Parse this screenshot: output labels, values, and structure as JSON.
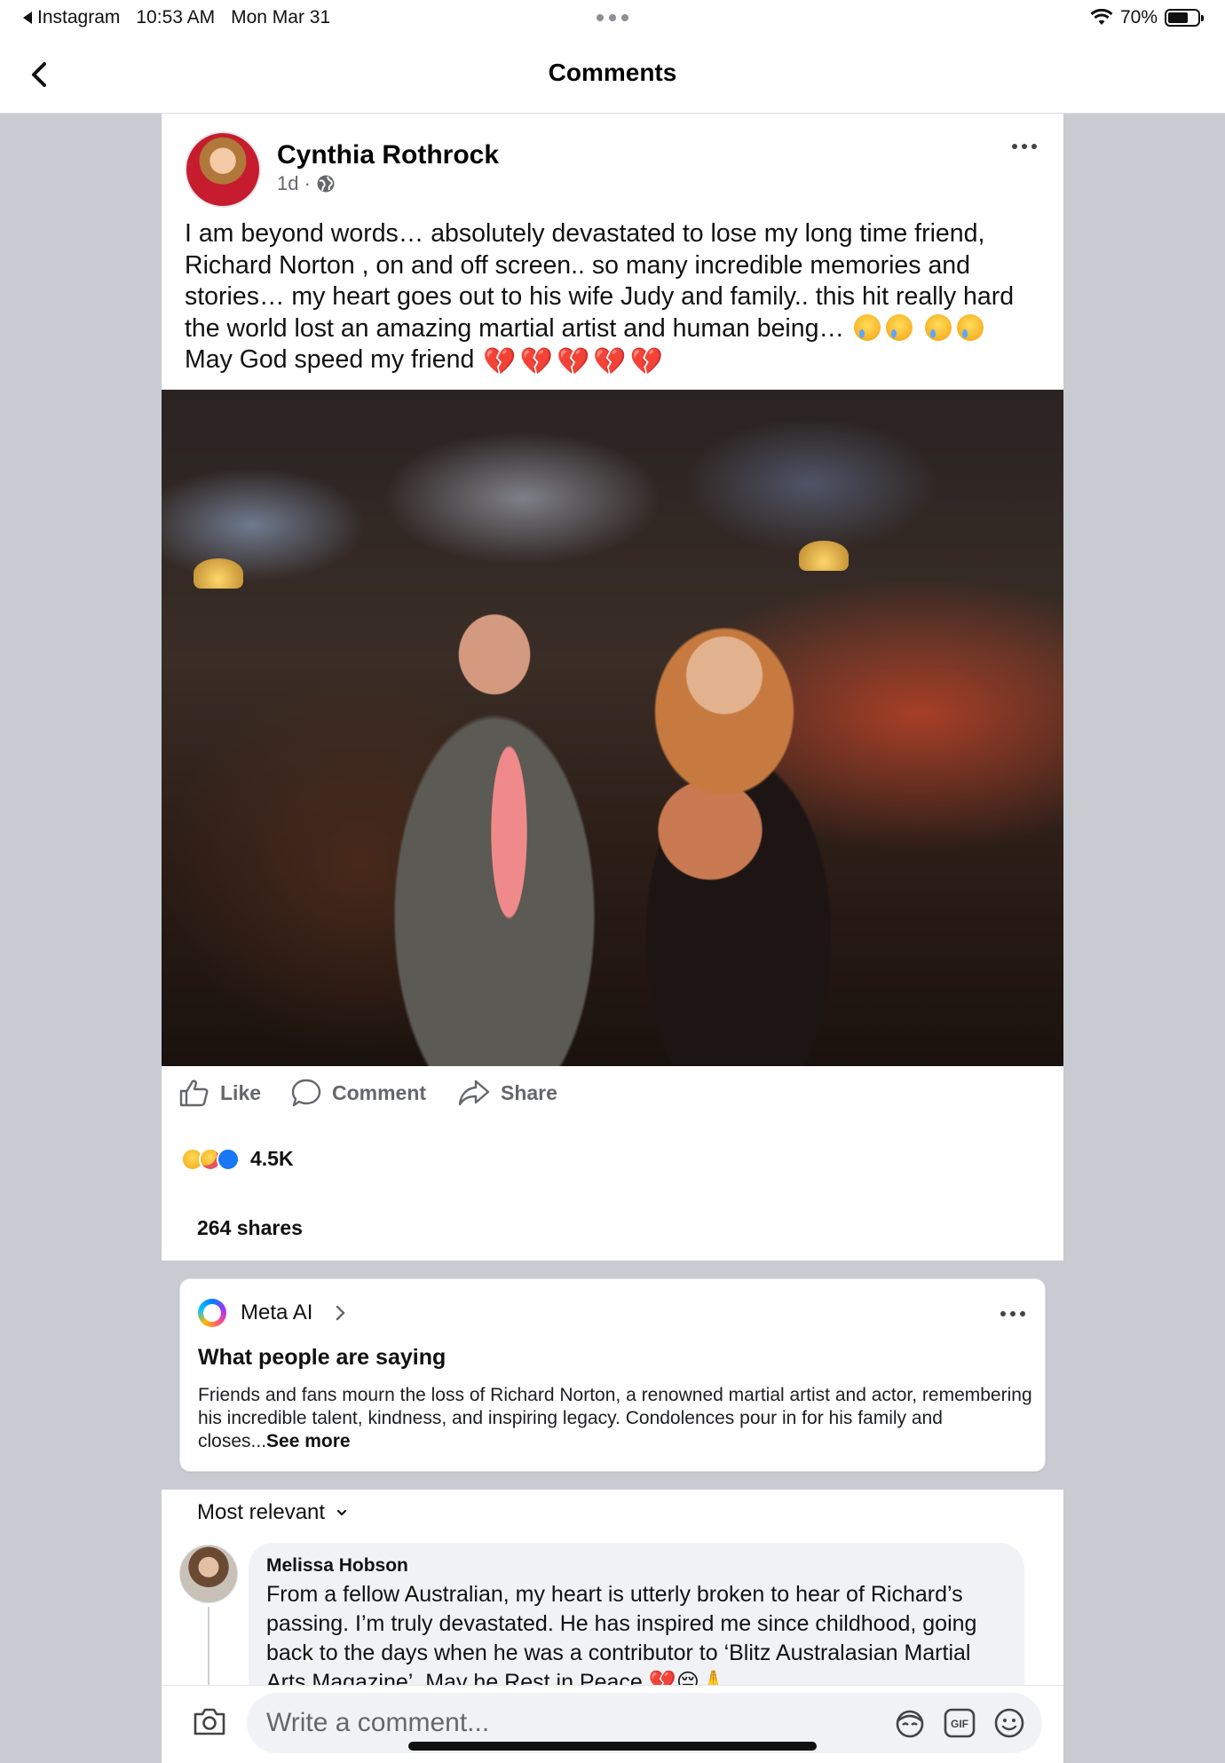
{
  "status_bar": {
    "back_app": "Instagram",
    "time": "10:53 AM",
    "date": "Mon Mar 31",
    "battery": "70%",
    "battery_level": 0.7
  },
  "nav": {
    "title": "Comments"
  },
  "post": {
    "author": "Cynthia Rothrock",
    "age": "1d",
    "privacy_icon": "globe-icon",
    "text_main": "I am beyond words… absolutely devastated to lose my long time friend, Richard Norton , on and off screen.. so many incredible memories and stories… my heart goes out to his wife Judy and family.. this hit really hard the world lost an amazing martial artist and human being…",
    "text_tail": "May God speed my friend",
    "actions": {
      "like": "Like",
      "comment": "Comment",
      "share": "Share"
    },
    "reaction_count": "4.5K",
    "shares": "264 shares"
  },
  "meta_ai": {
    "name": "Meta AI",
    "heading": "What people are saying",
    "summary": "Friends and fans mourn the loss of Richard Norton, a renowned martial artist and actor, remembering his incredible talent, kindness, and inspiring legacy. Condolences pour in for his family and closes...",
    "see_more": "See more"
  },
  "comments": {
    "sort_label": "Most relevant",
    "items": [
      {
        "author": "Melissa Hobson",
        "text": "From a fellow Australian, my heart is utterly broken to hear of Richard’s passing. I’m truly devastated. He has inspired me since childhood, going back to the days when he was a contributor to ‘Blitz Australasian Martial Arts Magazine’. May he Rest in Peace 💔😔🙏"
      }
    ]
  },
  "composer": {
    "placeholder": "Write a comment..."
  },
  "colors": {
    "accent": "#1877f2",
    "page_bg": "#c8cbd2",
    "muted_text": "#65676b",
    "bubble_bg": "#f0f2f5"
  }
}
